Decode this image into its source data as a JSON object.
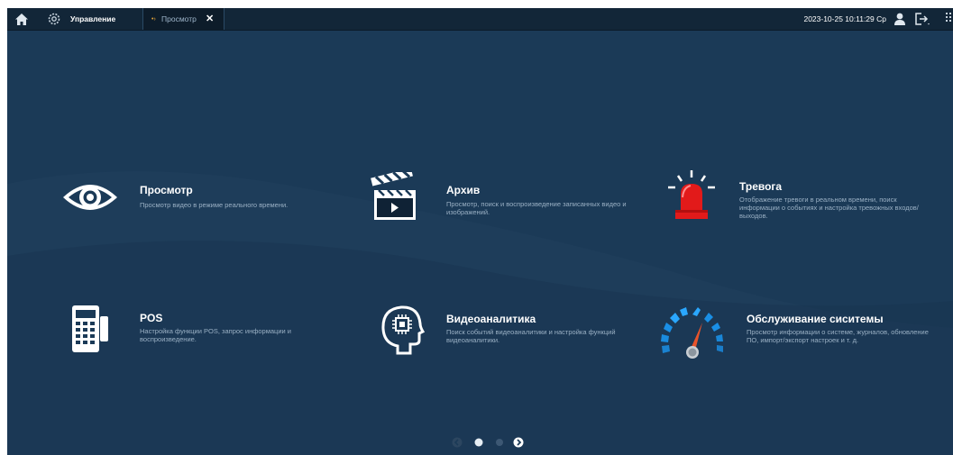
{
  "topbar": {
    "manage_label": "Управление",
    "live_tab_label": "Просмотр",
    "close_glyph": "✕",
    "datetime": "2023-10-25 10:11:29 Ср"
  },
  "tiles": [
    {
      "title": "Просмотр",
      "desc": "Просмотр видео в режиме реального времени."
    },
    {
      "title": "Архив",
      "desc": "Просмотр, поиск и воспроизведение записанных видео и изображений."
    },
    {
      "title": "Тревога",
      "desc": "Отображение тревоги в реальном времени, поиск информации о событиях и настройка тревожных входов/выходов."
    },
    {
      "title": "POS",
      "desc": "Настройка функции POS, запрос информации и воспроизведение."
    },
    {
      "title": "Видеоаналитика",
      "desc": "Поиск событий видеоаналитики и настройка функций видеоаналитики."
    },
    {
      "title": "Обслуживание сиситемы",
      "desc": "Просмотр информации о системе, журналов, обновление ПО, импорт/экспорт настроек и т. д."
    }
  ],
  "pagination": {
    "pages": 2,
    "current": 1
  },
  "colors": {
    "background": "#1b3a57",
    "topbar": "#122638",
    "accent_alarm": "#e21a1a"
  }
}
